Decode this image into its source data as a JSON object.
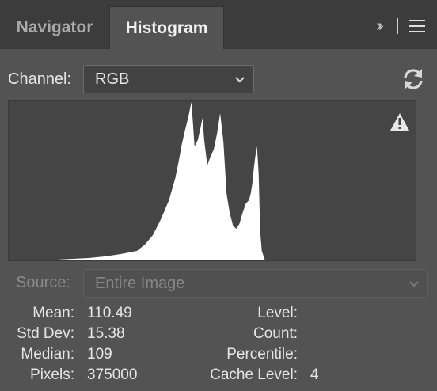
{
  "tabs": [
    {
      "label": "Navigator",
      "active": false
    },
    {
      "label": "Histogram",
      "active": true
    }
  ],
  "header_icons": [
    "expand-panel-icon",
    "panel-menu-icon"
  ],
  "channel": {
    "label": "Channel:",
    "value": "RGB"
  },
  "source": {
    "label": "Source:",
    "value": "Entire Image",
    "disabled": true
  },
  "stats": {
    "mean": {
      "label": "Mean:",
      "value": "110.49"
    },
    "std_dev": {
      "label": "Std Dev:",
      "value": "15.38"
    },
    "median": {
      "label": "Median:",
      "value": "109"
    },
    "pixels": {
      "label": "Pixels:",
      "value": "375000"
    },
    "level": {
      "label": "Level:",
      "value": ""
    },
    "count": {
      "label": "Count:",
      "value": ""
    },
    "percentile": {
      "label": "Percentile:",
      "value": ""
    },
    "cache_level": {
      "label": "Cache Level:",
      "value": "4"
    }
  },
  "colors": {
    "panel": "#535353",
    "tabbar": "#3c3c3c",
    "histogram_bg": "#454545",
    "histogram_fill": "#ffffff"
  },
  "chart_data": {
    "type": "area",
    "x": [
      0,
      20,
      30,
      40,
      50,
      60,
      70,
      80,
      85,
      90,
      95,
      100,
      102,
      104,
      106,
      108,
      110,
      112,
      113,
      114,
      115,
      116,
      118,
      120,
      121,
      122,
      124,
      126,
      128,
      130,
      132,
      134,
      136,
      138,
      140,
      142,
      144,
      146,
      148,
      150,
      151,
      152,
      153,
      154,
      155,
      156,
      157,
      158,
      160,
      255
    ],
    "values": [
      0,
      0,
      0.5,
      1,
      1.5,
      2.5,
      4,
      6,
      10,
      16,
      26,
      38,
      45,
      52,
      62,
      73,
      82,
      90,
      95,
      100,
      87,
      72,
      76,
      85,
      90,
      76,
      60,
      66,
      70,
      80,
      93,
      75,
      42,
      30,
      22,
      20,
      23,
      30,
      36,
      38,
      42,
      48,
      58,
      66,
      72,
      55,
      18,
      6,
      0,
      0
    ],
    "ylim": [
      0,
      100
    ],
    "xlim": [
      0,
      255
    ]
  }
}
